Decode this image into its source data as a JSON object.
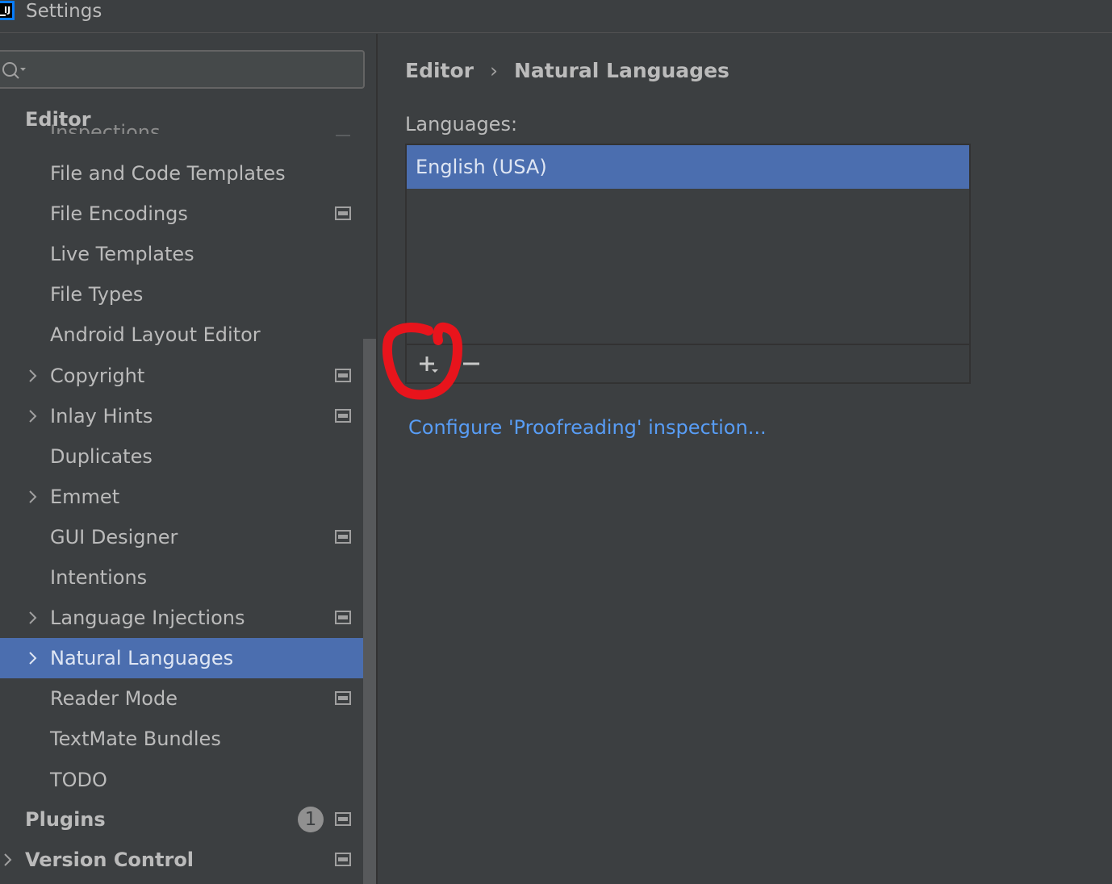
{
  "window": {
    "title": "Settings"
  },
  "search": {
    "value": "",
    "placeholder": ""
  },
  "sidebar": {
    "section_title": "Editor",
    "partial_item": "Inspections",
    "items": [
      {
        "label": "File and Code Templates",
        "expandable": false,
        "project_icon": false
      },
      {
        "label": "File Encodings",
        "expandable": false,
        "project_icon": true
      },
      {
        "label": "Live Templates",
        "expandable": false,
        "project_icon": false
      },
      {
        "label": "File Types",
        "expandable": false,
        "project_icon": false
      },
      {
        "label": "Android Layout Editor",
        "expandable": false,
        "project_icon": false
      },
      {
        "label": "Copyright",
        "expandable": true,
        "project_icon": true
      },
      {
        "label": "Inlay Hints",
        "expandable": true,
        "project_icon": true
      },
      {
        "label": "Duplicates",
        "expandable": false,
        "project_icon": false
      },
      {
        "label": "Emmet",
        "expandable": true,
        "project_icon": false
      },
      {
        "label": "GUI Designer",
        "expandable": false,
        "project_icon": true
      },
      {
        "label": "Intentions",
        "expandable": false,
        "project_icon": false
      },
      {
        "label": "Language Injections",
        "expandable": true,
        "project_icon": true
      },
      {
        "label": "Natural Languages",
        "expandable": true,
        "project_icon": false,
        "selected": true
      },
      {
        "label": "Reader Mode",
        "expandable": false,
        "project_icon": true
      },
      {
        "label": "TextMate Bundles",
        "expandable": false,
        "project_icon": false
      },
      {
        "label": "TODO",
        "expandable": false,
        "project_icon": false
      }
    ],
    "plugins": {
      "label": "Plugins",
      "badge": "1"
    },
    "version_control": {
      "label": "Version Control"
    }
  },
  "main": {
    "breadcrumb": {
      "parent": "Editor",
      "separator": "›",
      "current": "Natural Languages"
    },
    "languages_label": "Languages:",
    "languages": [
      "English (USA)"
    ],
    "toolbar": {
      "add_icon": "plus-icon",
      "remove_icon": "minus-icon"
    },
    "configure_link": "Configure 'Proofreading' inspection..."
  },
  "colors": {
    "background": "#3c3f41",
    "selection": "#4b6eaf",
    "link": "#589df6",
    "annotation": "#e8141c"
  }
}
